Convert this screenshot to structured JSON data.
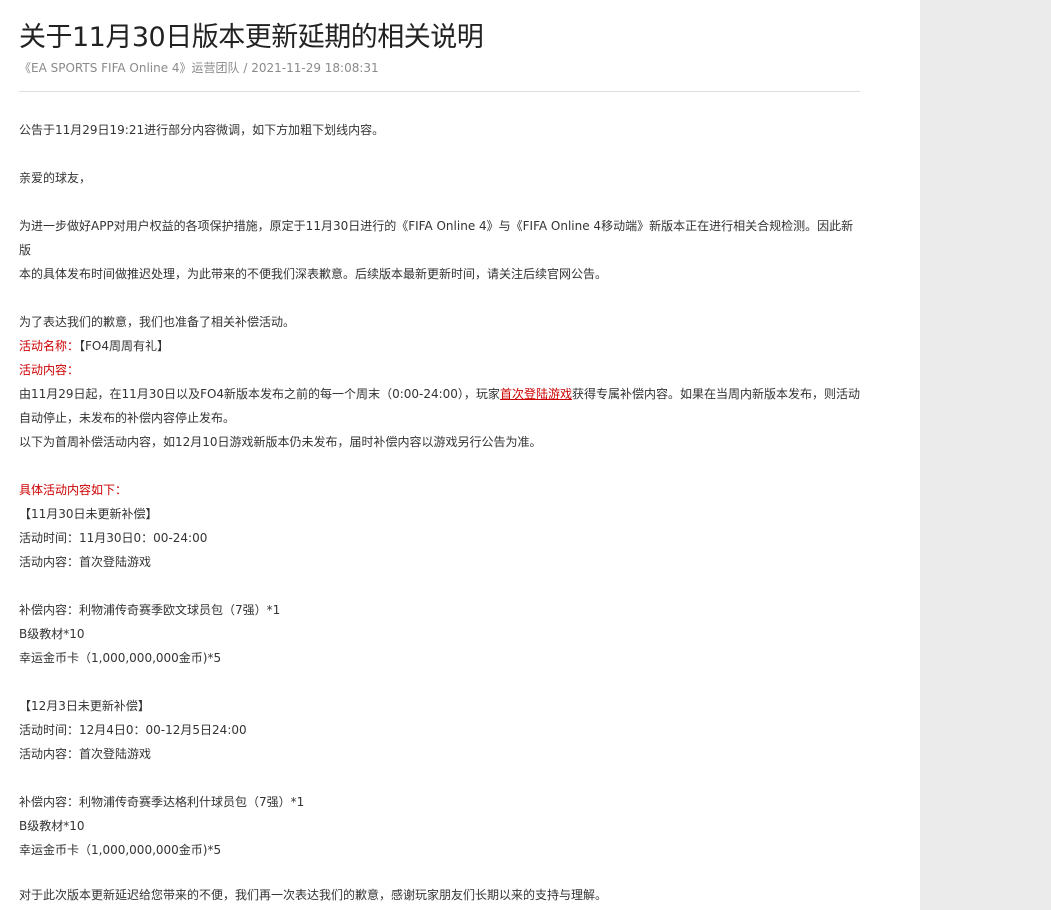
{
  "article": {
    "title": "关于11月30日版本更新延期的相关说明",
    "meta": {
      "source": "《EA SPORTS FIFA Online 4》运营团队",
      "separator": " / ",
      "datetime": "2021-11-29 18:08:31"
    }
  },
  "content": {
    "notice": "公告于11月29日19:21进行部分内容微调，如下方加粗下划线内容。",
    "greeting": "亲爱的球友，",
    "para1_line1": "为进一步做好APP对用户权益的各项保护措施，原定于11月30日进行的《FIFA Online 4》与《FIFA Online 4移动端》新版本正在进行相关合规检测。因此新版",
    "para1_line2": "本的具体发布时间做推迟处理，为此带来的不便我们深表歉意。后续版本最新更新时间，请关注后续官网公告。",
    "apology": "为了表达我们的歉意，我们也准备了相关补偿活动。",
    "activity_name_label": "活动名称：",
    "activity_name_value": "【FO4周周有礼】",
    "activity_content_label": "活动内容：",
    "desc_line1_pre": "由11月29日起，在11月30日以及FO4新版本发布之前的每一个周末（0:00-24:00），玩家",
    "desc_line1_link": "首次登陆游戏",
    "desc_line1_post": "获得专属补偿内容。如果在当周内新版本发布，则活动",
    "desc_line2": "自动停止，未发布的补偿内容停止发布。",
    "desc_line3": "以下为首周补偿活动内容，如12月10日游戏新版本仍未发布，届时补偿内容以游戏另行公告为准。",
    "details_heading": "具体活动内容如下：",
    "week1": {
      "header": "【11月30日未更新补偿】",
      "time": "活动时间：11月30日0：00-24:00",
      "content": "活动内容：首次登陆游戏",
      "reward1": "补偿内容：利物浦传奇赛季欧文球员包（7强）*1",
      "reward2": "B级教材*10",
      "reward3": "幸运金币卡（1,000,000,000金币)*5"
    },
    "week2": {
      "header": "【12月3日未更新补偿】",
      "time": "活动时间：12月4日0：00-12月5日24:00",
      "content": "活动内容：首次登陆游戏",
      "reward1": "补偿内容：利物浦传奇赛季达格利什球员包（7强）*1",
      "reward2": "B级教材*10",
      "reward3": "幸运金币卡（1,000,000,000金币)*5"
    },
    "closing": "对于此次版本更新延迟给您带来的不便，我们再一次表达我们的歉意，感谢玩家朋友们长期以来的支持与理解。"
  },
  "colors": {
    "accent_red": "#cc0000",
    "sidebar_gray": "#ebebeb"
  }
}
